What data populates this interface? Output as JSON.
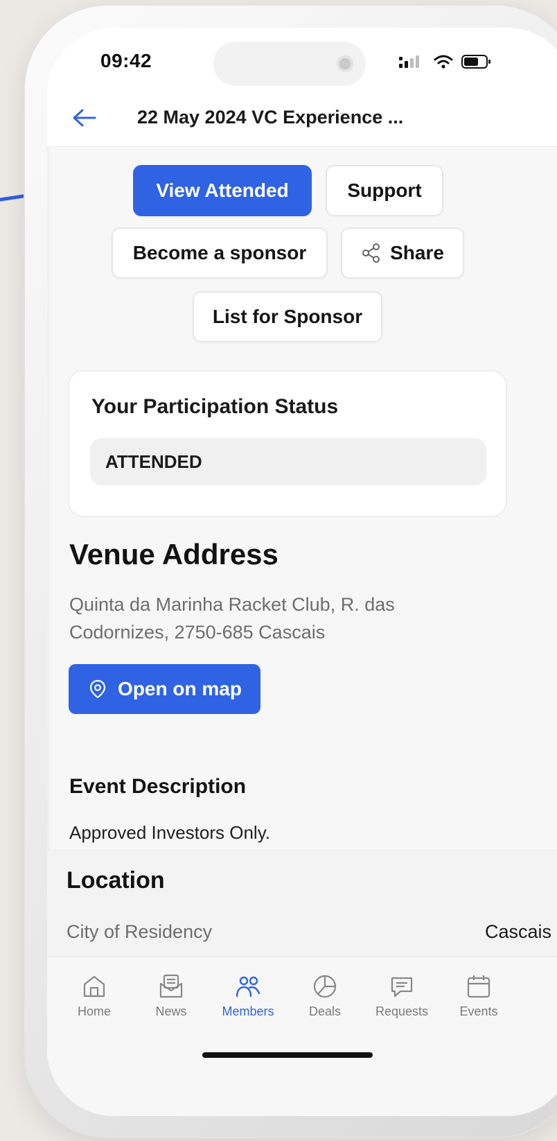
{
  "status_bar": {
    "time": "09:42"
  },
  "header": {
    "title": "22 May 2024 VC Experience ..."
  },
  "actions": {
    "view_attended": "View Attended",
    "support": "Support",
    "become_sponsor": "Become a sponsor",
    "share": "Share",
    "list_for_sponsor": "List for Sponsor"
  },
  "participation": {
    "title": "Your Participation Status",
    "status": "ATTENDED"
  },
  "venue": {
    "title": "Venue Address",
    "address": "Quinta da Marinha Racket Club, R. das Codornizes, 2750-685 Cascais",
    "map_button": "Open on map"
  },
  "description": {
    "title": "Event Description",
    "text": "Approved Investors Only."
  },
  "location": {
    "title": "Location",
    "label": "City of Residency",
    "value": "Cascais"
  },
  "tabs": [
    {
      "label": "Home",
      "icon": "home-icon"
    },
    {
      "label": "News",
      "icon": "news-icon"
    },
    {
      "label": "Members",
      "icon": "members-icon",
      "active": true
    },
    {
      "label": "Deals",
      "icon": "deals-icon"
    },
    {
      "label": "Requests",
      "icon": "requests-icon"
    },
    {
      "label": "Events",
      "icon": "events-icon"
    }
  ],
  "colors": {
    "accent": "#2f63e3",
    "annotation_arrow": "#2f5fdc",
    "background": "#ece8e4"
  }
}
